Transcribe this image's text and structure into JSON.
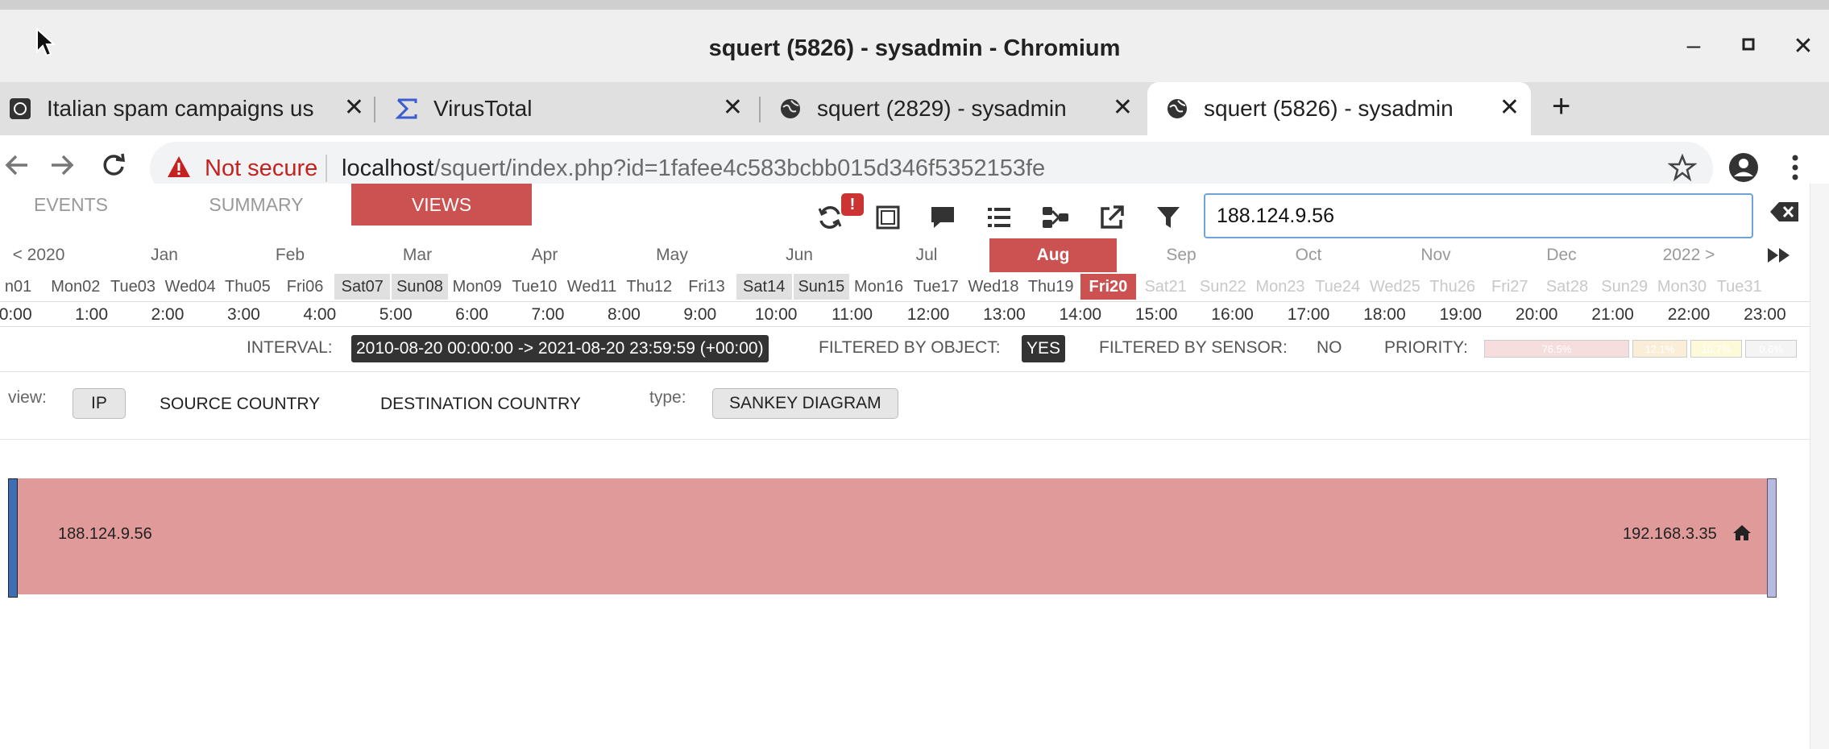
{
  "window": {
    "title": "squert (5826) - sysadmin - Chromium"
  },
  "tabs": [
    {
      "label": "Italian spam campaigns us",
      "favicon": "globe-dark-icon"
    },
    {
      "label": "VirusTotal",
      "favicon": "sigma-icon"
    },
    {
      "label": "squert (2829) - sysadmin",
      "favicon": "globe-icon"
    },
    {
      "label": "squert (5826) - sysadmin",
      "favicon": "globe-icon",
      "active": true
    }
  ],
  "toolbar": {
    "security_label": "Not secure",
    "url_host": "localhost",
    "url_path": "/squert/index.php?id=1fafee4c583bcbb015d346f5352153fe"
  },
  "nav": {
    "events": "EVENTS",
    "summary": "SUMMARY",
    "views": "VIEWS",
    "alert_badge": "!"
  },
  "search": {
    "value": "188.124.9.56"
  },
  "months": [
    "< 2020",
    "Jan",
    "Feb",
    "Mar",
    "Apr",
    "May",
    "Jun",
    "Jul",
    "Aug",
    "Sep",
    "Oct",
    "Nov",
    "Dec",
    "2022 >"
  ],
  "active_month": "Aug",
  "days": [
    "n01",
    "Mon02",
    "Tue03",
    "Wed04",
    "Thu05",
    "Fri06",
    "Sat07",
    "Sun08",
    "Mon09",
    "Tue10",
    "Wed11",
    "Thu12",
    "Fri13",
    "Sat14",
    "Sun15",
    "Mon16",
    "Tue17",
    "Wed18",
    "Thu19",
    "Fri20",
    "Sat21",
    "Sun22",
    "Mon23",
    "Tue24",
    "Wed25",
    "Thu26",
    "Fri27",
    "Sat28",
    "Sun29",
    "Mon30",
    "Tue31"
  ],
  "today": "Fri20",
  "hours": [
    "0:00",
    "1:00",
    "2:00",
    "3:00",
    "4:00",
    "5:00",
    "6:00",
    "7:00",
    "8:00",
    "9:00",
    "10:00",
    "11:00",
    "12:00",
    "13:00",
    "14:00",
    "15:00",
    "16:00",
    "17:00",
    "18:00",
    "19:00",
    "20:00",
    "21:00",
    "22:00",
    "23:00"
  ],
  "filters": {
    "interval_label": "INTERVAL:",
    "interval_value": "2010-08-20 00:00:00 -> 2021-08-20 23:59:59 (+00:00)",
    "object_label": "FILTERED BY OBJECT:",
    "object_value": "YES",
    "sensor_label": "FILTERED BY SENSOR:",
    "sensor_value": "NO",
    "priority_label": "PRIORITY:",
    "priority": [
      {
        "label": "76.5%",
        "color": "#f7dede"
      },
      {
        "label": "12.1%",
        "color": "#fbeed9"
      },
      {
        "label": "10.7%",
        "color": "#fcfad8"
      },
      {
        "label": "0.6%",
        "color": "#f4f4f4"
      }
    ]
  },
  "view": {
    "view_label": "view:",
    "ip": "IP",
    "source_country": "SOURCE COUNTRY",
    "destination_country": "DESTINATION COUNTRY",
    "type_label": "type:",
    "type_value": "SANKEY DIAGRAM"
  },
  "sankey": {
    "source": "188.124.9.56",
    "destination": "192.168.3.35",
    "flow_color": "#e09a9a"
  }
}
